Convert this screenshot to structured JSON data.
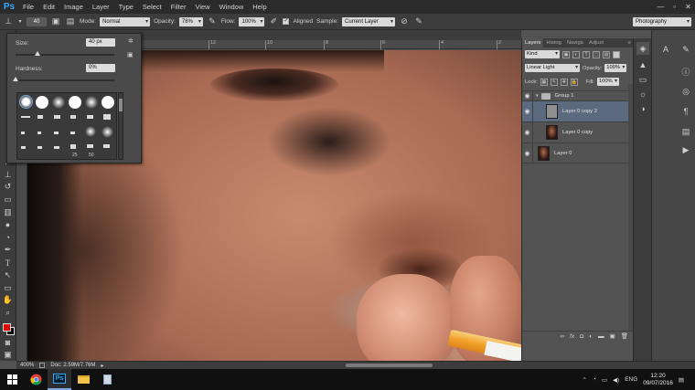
{
  "app": {
    "logo": "Ps",
    "menu": [
      "File",
      "Edit",
      "Image",
      "Layer",
      "Type",
      "Select",
      "Filter",
      "View",
      "Window",
      "Help"
    ],
    "window_controls": [
      "—",
      "▫",
      "✕"
    ]
  },
  "options_bar": {
    "brush_size": "40",
    "mode_label": "Mode:",
    "mode_value": "Normal",
    "opacity_label": "Opacity:",
    "opacity_value": "78%",
    "flow_label": "Flow:",
    "flow_value": "100%",
    "aligned_label": "Aligned",
    "sample_label": "Sample:",
    "sample_value": "Current Layer",
    "workspace": "Photography"
  },
  "brush_picker": {
    "size_label": "Size:",
    "size_value": "40 px",
    "hardness_label": "Hardness:",
    "hardness_value": "0%",
    "size_fraction": 0.22,
    "hardness_fraction": 0.0,
    "preset_numbers": [
      "25",
      "50"
    ]
  },
  "ruler": {
    "ticks": [
      "12",
      "10",
      "8",
      "6",
      "4",
      "2",
      "0",
      "2"
    ]
  },
  "layers_panel": {
    "tabs": [
      "Layers",
      "Histog",
      "Naviga",
      "Adjust"
    ],
    "active_tab": "Layers",
    "filter_value": "Kind",
    "blend_mode": "Linear Light",
    "opacity_label": "Opacity:",
    "opacity_value": "100%",
    "lock_label": "Lock:",
    "fill_label": "Fill:",
    "fill_value": "100%",
    "layers": [
      {
        "name": "Group 1",
        "type": "group",
        "selected": false
      },
      {
        "name": "Layer 0 copy 2",
        "type": "layer",
        "selected": true
      },
      {
        "name": "Layer 0 copy",
        "type": "layer",
        "selected": false
      },
      {
        "name": "Layer 0",
        "type": "layer",
        "selected": false
      }
    ]
  },
  "status": {
    "zoom": "400%",
    "doc": "Doc: 2.59M/7.76M"
  },
  "taskbar": {
    "language": "ENG",
    "time": "12:20",
    "date": "09/07/2016"
  },
  "colors": {
    "foreground": "#e50000",
    "background": "#000000",
    "accent": "#31a8ff"
  }
}
